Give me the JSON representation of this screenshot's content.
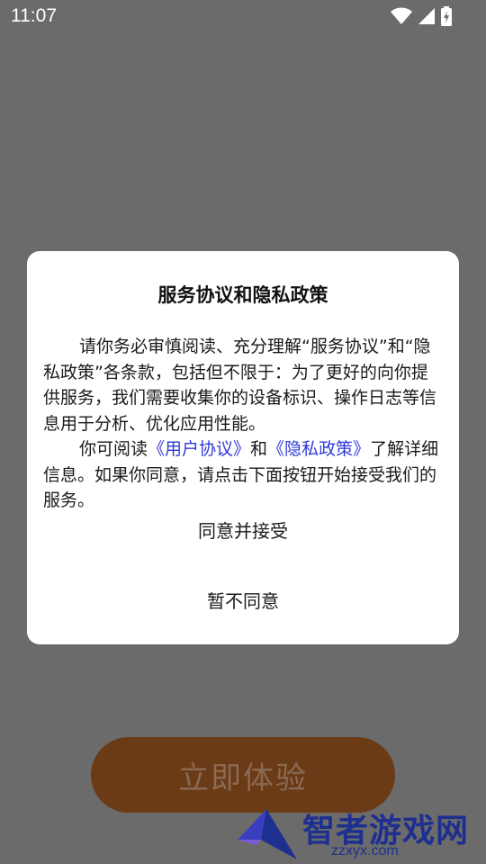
{
  "status_bar": {
    "time": "11:07",
    "icons": [
      "wifi-icon",
      "signal-icon",
      "battery-charging-icon"
    ]
  },
  "background": {
    "cta_label": "立即体验"
  },
  "dialog": {
    "title": "服务协议和隐私政策",
    "para1": "请你务必审慎阅读、充分理解“服务协议”和“隐私政策”各条款，包括但不限于：为了更好的向你提供服务，我们需要收集你的设备标识、操作日志等信息用于分析、优化应用性能。",
    "para2_prefix": "你可阅读",
    "link_user_agreement": "《用户协议》",
    "para2_mid": "和",
    "link_privacy_policy": "《隐私政策》",
    "para2_suffix": "了解详细信息。如果你同意，请点击下面按钮开始接受我们的服务。",
    "agree_label": "同意并接受",
    "decline_label": "暂不同意"
  },
  "watermark": {
    "brand": "智者游戏网",
    "domain": "zzxyx.com"
  },
  "colors": {
    "overlay": "#6b6b6b",
    "link": "#2f3bd6",
    "cta": "#6b3a17",
    "watermark": "#1d2f8f"
  }
}
